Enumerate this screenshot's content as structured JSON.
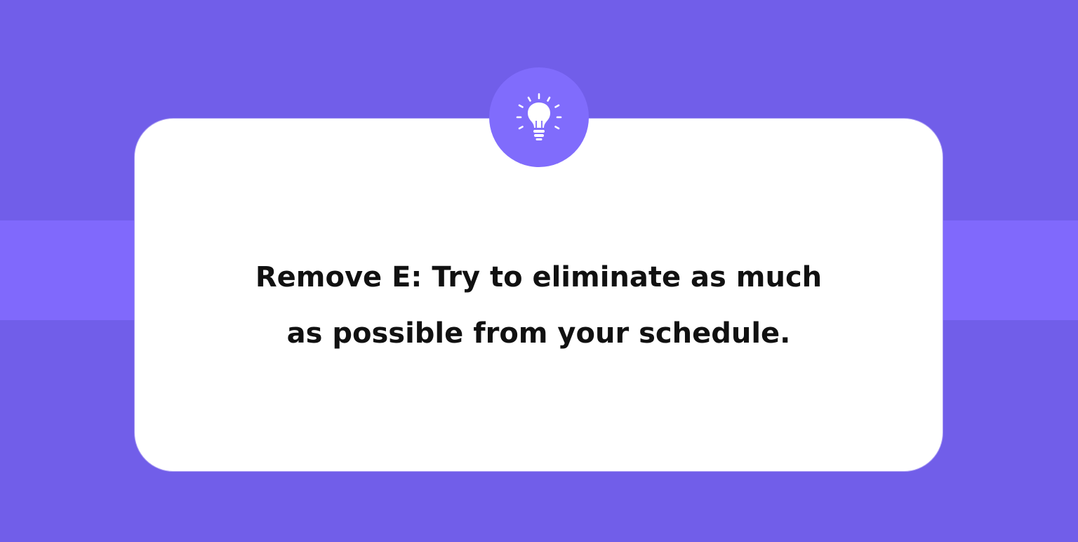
{
  "tip": {
    "icon": "lightbulb-icon",
    "lines": [
      "Remove E: Try to eliminate as much",
      "as possible from your schedule."
    ]
  },
  "colors": {
    "background": "#715ee9",
    "band": "#8069fc",
    "card": "#ffffff",
    "badge": "#806cfc",
    "text": "#111111"
  }
}
